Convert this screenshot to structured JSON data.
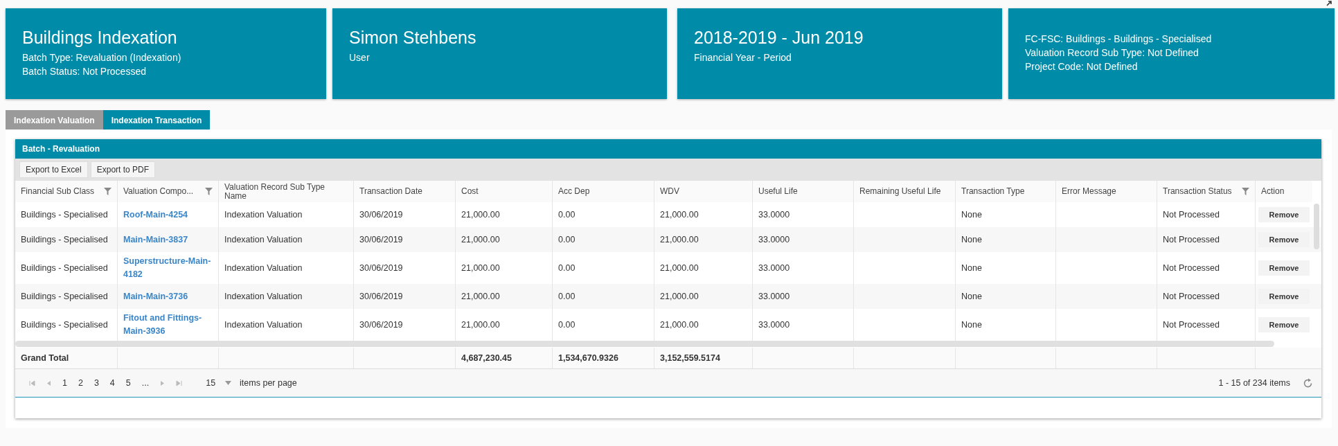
{
  "cards": [
    {
      "title": "Buildings Indexation",
      "lines": [
        "Batch Type: Revaluation (Indexation)",
        "Batch Status: Not Processed"
      ]
    },
    {
      "title": "Simon Stehbens",
      "lines": [
        "User"
      ]
    },
    {
      "title": "2018-2019 - Jun 2019",
      "lines": [
        "Financial Year - Period"
      ]
    },
    {
      "lines": [
        "FC-FSC: Buildings - Buildings - Specialised",
        "Valuation Record Sub Type: Not Defined",
        "Project Code: Not Defined"
      ]
    }
  ],
  "tabs": [
    {
      "label": "Indexation Valuation",
      "selected": false
    },
    {
      "label": "Indexation Transaction",
      "selected": true
    }
  ],
  "panel": {
    "title": "Batch - Revaluation",
    "toolbar": [
      "Export to Excel",
      "Export to PDF"
    ]
  },
  "table": {
    "columns": [
      {
        "label": "Financial Sub Class",
        "filter": true
      },
      {
        "label": "Valuation Compo...",
        "filter": true
      },
      {
        "label": "Valuation Record Sub Type Name",
        "filter": false
      },
      {
        "label": "Transaction Date",
        "filter": false
      },
      {
        "label": "Cost",
        "filter": false
      },
      {
        "label": "Acc Dep",
        "filter": false
      },
      {
        "label": "WDV",
        "filter": false
      },
      {
        "label": "Useful Life",
        "filter": false
      },
      {
        "label": "Remaining Useful Life",
        "filter": false
      },
      {
        "label": "Transaction Type",
        "filter": false
      },
      {
        "label": "Error Message",
        "filter": false
      },
      {
        "label": "Transaction Status",
        "filter": true
      },
      {
        "label": "Action",
        "filter": false
      }
    ],
    "rows": [
      {
        "cells": [
          "Buildings - Specialised",
          "Roof-Main-4254",
          "Indexation Valuation",
          "30/06/2019",
          "21,000.00",
          "0.00",
          "21,000.00",
          "33.0000",
          "",
          "None",
          "",
          "Not Processed"
        ],
        "action": "Remove"
      },
      {
        "cells": [
          "Buildings - Specialised",
          "Main-Main-3837",
          "Indexation Valuation",
          "30/06/2019",
          "21,000.00",
          "0.00",
          "21,000.00",
          "33.0000",
          "",
          "None",
          "",
          "Not Processed"
        ],
        "action": "Remove"
      },
      {
        "cells": [
          "Buildings - Specialised",
          "Superstructure-Main-4182",
          "Indexation Valuation",
          "30/06/2019",
          "21,000.00",
          "0.00",
          "21,000.00",
          "33.0000",
          "",
          "None",
          "",
          "Not Processed"
        ],
        "action": "Remove"
      },
      {
        "cells": [
          "Buildings - Specialised",
          "Main-Main-3736",
          "Indexation Valuation",
          "30/06/2019",
          "21,000.00",
          "0.00",
          "21,000.00",
          "33.0000",
          "",
          "None",
          "",
          "Not Processed"
        ],
        "action": "Remove"
      },
      {
        "cells": [
          "Buildings - Specialised",
          "Fitout and Fittings-Main-3936",
          "Indexation Valuation",
          "30/06/2019",
          "21,000.00",
          "0.00",
          "21,000.00",
          "33.0000",
          "",
          "None",
          "",
          "Not Processed"
        ],
        "action": "Remove"
      }
    ],
    "footer": {
      "label": "Grand Total",
      "cost": "4,687,230.45",
      "acc_dep": "1,534,670.9326",
      "wdv": "3,152,559.5174"
    }
  },
  "pager": {
    "pages": [
      "1",
      "2",
      "3",
      "4",
      "5",
      "..."
    ],
    "page_size": "15",
    "page_size_label": "items per page",
    "summary": "1 - 15 of 234 items"
  }
}
